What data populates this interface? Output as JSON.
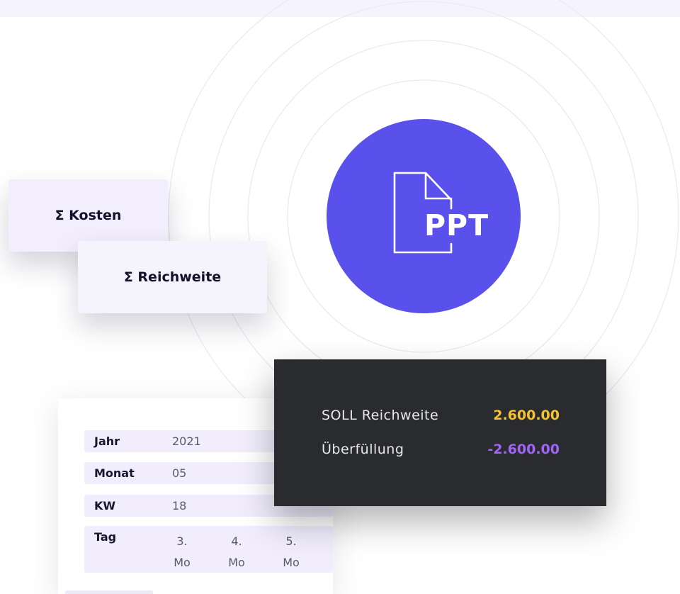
{
  "ppt": {
    "label": "PPT",
    "icon": "file-icon",
    "color": "#5a50eb"
  },
  "sum_cards": {
    "kosten": "Σ Kosten",
    "reichweite": "Σ Reichweite"
  },
  "date_table": {
    "jahr": {
      "label": "Jahr",
      "value": "2021"
    },
    "monat": {
      "label": "Monat",
      "value": "05"
    },
    "kw": {
      "label": "KW",
      "value": "18"
    },
    "tag": {
      "label": "Tag",
      "days": [
        {
          "num": "3.",
          "name": "Mo"
        },
        {
          "num": "4.",
          "name": "Mo"
        },
        {
          "num": "5.",
          "name": "Mo"
        }
      ]
    }
  },
  "summary": {
    "soll_label": "SOLL Reichweite",
    "soll_value": "2.600.00",
    "soll_color": "#f5c232",
    "ueber_label": "Überfüllung",
    "ueber_value": "-2.600.00",
    "ueber_color": "#a065f7"
  }
}
